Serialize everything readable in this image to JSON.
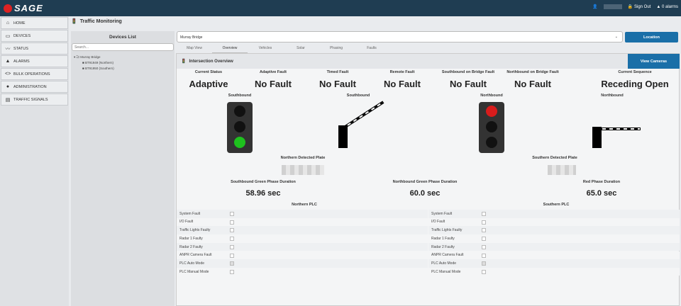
{
  "header": {
    "brand": "SAGE",
    "sign_out": "Sign Out",
    "alarms": "0 alarms"
  },
  "sidebar": {
    "items": [
      {
        "label": "HOME",
        "icon": "⌂"
      },
      {
        "label": "DEVICES",
        "icon": "▭"
      },
      {
        "label": "STATUS",
        "icon": "〰"
      },
      {
        "label": "ALARMS",
        "icon": "▲"
      },
      {
        "label": "BULK OPERATIONS",
        "icon": "<>"
      },
      {
        "label": "ADMINISTRATION",
        "icon": "●"
      },
      {
        "label": "TRAFFIC SIGNALS",
        "icon": "▤"
      }
    ]
  },
  "page_title": "Traffic Monitoring",
  "devices": {
    "title": "Devices List",
    "search_placeholder": "Search...",
    "root": "Murray Bridge",
    "children": [
      "BT91949 (Northern)",
      "BT91950 (Southern)"
    ]
  },
  "location": {
    "value": "Murray Bridge",
    "button": "Location"
  },
  "tabs": [
    {
      "label": "Map View"
    },
    {
      "label": "Overview",
      "active": true
    },
    {
      "label": "Vehicles"
    },
    {
      "label": "Solar"
    },
    {
      "label": "Phasing"
    },
    {
      "label": "Faults"
    }
  ],
  "overview": {
    "title": "Intersection Overview",
    "view_cameras": "View Cameras",
    "stats": [
      {
        "label": "Current Status",
        "value": "Adaptive"
      },
      {
        "label": "Adaptive Fault",
        "value": "No Fault"
      },
      {
        "label": "Timed Fault",
        "value": "No Fault"
      },
      {
        "label": "Remote Fault",
        "value": "No Fault"
      },
      {
        "label": "Southbound on Bridge Fault",
        "value": "No Fault"
      },
      {
        "label": "Northbound on Bridge Fault",
        "value": "No Fault"
      },
      {
        "label": "Current Sequence",
        "value": "Receding Open"
      }
    ],
    "signals": [
      {
        "label": "Southbound",
        "state": "green"
      },
      {
        "label": "Southbound",
        "barrier": "open"
      },
      {
        "label": "Northbound",
        "state": "red"
      },
      {
        "label": "Northbound",
        "barrier": "closed"
      }
    ],
    "plates": [
      {
        "label": "Northern Detected Plate"
      },
      {
        "label": "Southern Detected Plate"
      }
    ],
    "durations": [
      {
        "label": "Southbound Green Phase Duration",
        "value": "58.96 sec"
      },
      {
        "label": "Northbound Green Phase Duration",
        "value": "60.0 sec"
      },
      {
        "label": "Red Phase Duration",
        "value": "65.0 sec"
      }
    ],
    "plc": [
      {
        "title": "Northern PLC",
        "rows": [
          {
            "label": "System Fault",
            "checked": false
          },
          {
            "label": "I/O Fault",
            "checked": false
          },
          {
            "label": "Traffic Lights Faulty",
            "checked": false
          },
          {
            "label": "Radar 1 Faulty",
            "checked": false
          },
          {
            "label": "Radar 2 Faulty",
            "checked": false
          },
          {
            "label": "ANPR Camera Fault",
            "checked": false
          },
          {
            "label": "PLC Auto Mode",
            "checked": true
          },
          {
            "label": "PLC Manual Mode",
            "checked": false
          }
        ]
      },
      {
        "title": "Southern PLC",
        "rows": [
          {
            "label": "System Fault",
            "checked": false
          },
          {
            "label": "I/O Fault",
            "checked": false
          },
          {
            "label": "Traffic Lights Faulty",
            "checked": false
          },
          {
            "label": "Radar 1 Faulty",
            "checked": false
          },
          {
            "label": "Radar 2 Faulty",
            "checked": false
          },
          {
            "label": "ANPR Camera Fault",
            "checked": false
          },
          {
            "label": "PLC Auto Mode",
            "checked": true
          },
          {
            "label": "PLC Manual Mode",
            "checked": false
          }
        ]
      }
    ]
  }
}
